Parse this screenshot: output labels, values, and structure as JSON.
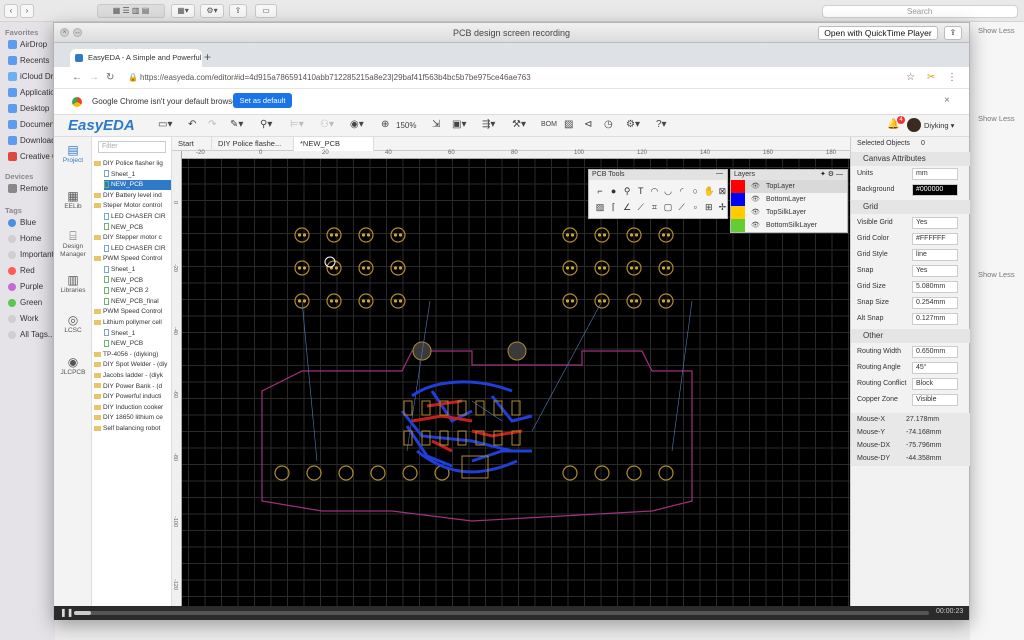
{
  "finder": {
    "search_placeholder": "Search",
    "sidebar": {
      "favorites_title": "Favorites",
      "favorites": [
        "AirDrop",
        "Recents",
        "iCloud Drive",
        "Applications",
        "Desktop",
        "Documents",
        "Downloads",
        "Creative Cloud"
      ],
      "devices_title": "Devices",
      "devices": [
        "Remote"
      ],
      "tags_title": "Tags",
      "tags": [
        {
          "label": "Blue",
          "color": "#4a90e2"
        },
        {
          "label": "Home",
          "color": "#cfcfcf"
        },
        {
          "label": "Important",
          "color": "#cfcfcf"
        },
        {
          "label": "Red",
          "color": "#ff5b50"
        },
        {
          "label": "Purple",
          "color": "#c36ad6"
        },
        {
          "label": "Green",
          "color": "#5ac84e"
        },
        {
          "label": "Work",
          "color": "#cfcfcf"
        },
        {
          "label": "All Tags...",
          "color": "#cfcfcf"
        }
      ]
    },
    "show_less_label": "Show Less"
  },
  "quicktime": {
    "title": "PCB design screen recording",
    "open_button": "Open with QuickTime Player",
    "time": "00:00:23",
    "progress_fraction": 0.02
  },
  "browser": {
    "tab_title": "EasyEDA - A Simple and Powerful Electronic Circuit Design Tool",
    "url": "https://easyeda.com/editor#id=4d915a786591410abb712285215a8e23|29baf41f563b4bc5b7be975ce46ae763",
    "infobar_text": "Google Chrome isn't your default browser",
    "set_default_label": "Set as default"
  },
  "eda": {
    "logo": "EasyEDA",
    "zoom": "150%",
    "bom_label": "BOM",
    "user": "Diyking",
    "notif_count": "4",
    "left_nav": [
      {
        "label": "Project",
        "icon": "folder-icon"
      },
      {
        "label": "EELib",
        "icon": "library-icon"
      },
      {
        "label": "Design Manager",
        "icon": "design-manager-icon"
      },
      {
        "label": "Libraries",
        "icon": "libraries-icon"
      },
      {
        "label": "LCSC",
        "icon": "lcsc-icon"
      },
      {
        "label": "JLCPCB",
        "icon": "jlcpcb-icon"
      }
    ],
    "filter_placeholder": "Filter",
    "tree": [
      {
        "label": "DIY Police flasher lig",
        "type": "folder",
        "indent": 0,
        "selected": false
      },
      {
        "label": "Sheet_1",
        "type": "sch",
        "indent": 1,
        "selected": false
      },
      {
        "label": "NEW_PCB",
        "type": "pcb",
        "indent": 1,
        "selected": true
      },
      {
        "label": "DIY Battery level ind",
        "type": "folder",
        "indent": 0,
        "selected": false
      },
      {
        "label": "Steper Motor control",
        "type": "folder",
        "indent": 0,
        "selected": false
      },
      {
        "label": "LED CHASER CIR",
        "type": "sch",
        "indent": 1,
        "selected": false
      },
      {
        "label": "NEW_PCB",
        "type": "pcb",
        "indent": 1,
        "selected": false
      },
      {
        "label": "DIY Stepper motor c",
        "type": "folder",
        "indent": 0,
        "selected": false
      },
      {
        "label": "LED CHASER CIR",
        "type": "sch",
        "indent": 1,
        "selected": false
      },
      {
        "label": "PWM Speed Control",
        "type": "folder",
        "indent": 0,
        "selected": false
      },
      {
        "label": "Sheet_1",
        "type": "sch",
        "indent": 1,
        "selected": false
      },
      {
        "label": "NEW_PCB",
        "type": "pcb",
        "indent": 1,
        "selected": false
      },
      {
        "label": "NEW_PCB 2",
        "type": "pcb",
        "indent": 1,
        "selected": false
      },
      {
        "label": "NEW_PCB_final",
        "type": "pcb",
        "indent": 1,
        "selected": false
      },
      {
        "label": "PWM Speed Control",
        "type": "folder",
        "indent": 0,
        "selected": false
      },
      {
        "label": "Lithium pollymer cell",
        "type": "folder",
        "indent": 0,
        "selected": false
      },
      {
        "label": "Sheet_1",
        "type": "sch",
        "indent": 1,
        "selected": false
      },
      {
        "label": "NEW_PCB",
        "type": "pcb",
        "indent": 1,
        "selected": false
      },
      {
        "label": "TP-4056 - (diyking)",
        "type": "folder",
        "indent": 0,
        "selected": false
      },
      {
        "label": "DIY Spot Welder - (diy",
        "type": "folder",
        "indent": 0,
        "selected": false
      },
      {
        "label": "Jacobs ladder - (diyk",
        "type": "folder",
        "indent": 0,
        "selected": false
      },
      {
        "label": "DIY Power Bank - (d",
        "type": "folder",
        "indent": 0,
        "selected": false
      },
      {
        "label": "DIY Powerful inducti",
        "type": "folder",
        "indent": 0,
        "selected": false
      },
      {
        "label": "DIY Induction cooker",
        "type": "folder",
        "indent": 0,
        "selected": false
      },
      {
        "label": "DIY 18650 lithium ce",
        "type": "folder",
        "indent": 0,
        "selected": false
      },
      {
        "label": "Self balancing robot",
        "type": "folder",
        "indent": 0,
        "selected": false
      }
    ],
    "doc_tabs": [
      {
        "label": "Start",
        "active": false
      },
      {
        "label": "DIY Police flashe...",
        "active": false
      },
      {
        "label": "*NEW_PCB",
        "active": true
      }
    ],
    "ruler_top": [
      "-20",
      "0",
      "20",
      "40",
      "60",
      "80",
      "100",
      "120",
      "140",
      "160",
      "180"
    ],
    "ruler_left": [
      "0",
      "-20",
      "-40",
      "-60",
      "-80",
      "-100",
      "-120"
    ],
    "pcb_tools_title": "PCB Tools",
    "layers_title": "Layers",
    "layers": [
      {
        "name": "TopLayer",
        "color": "#ff0000",
        "active": true
      },
      {
        "name": "BottomLayer",
        "color": "#0000ff",
        "active": false
      },
      {
        "name": "TopSilkLayer",
        "color": "#ffcc00",
        "active": false
      },
      {
        "name": "BottomSilkLayer",
        "color": "#66cc33",
        "active": false
      }
    ],
    "right_panel": {
      "selected_label": "Selected Objects",
      "selected_count": "0",
      "canvas_attrs_title": "Canvas Attributes",
      "units_label": "Units",
      "units": "mm",
      "background_label": "Background",
      "background": "#000000",
      "grid_title": "Grid",
      "visible_grid_label": "Visible Grid",
      "visible_grid": "Yes",
      "grid_color_label": "Grid Color",
      "grid_color": "#FFFFFF",
      "grid_style_label": "Grid Style",
      "grid_style": "line",
      "snap_label": "Snap",
      "snap": "Yes",
      "grid_size_label": "Grid Size",
      "grid_size": "5.080mm",
      "snap_size_label": "Snap Size",
      "snap_size": "0.254mm",
      "alt_snap_label": "Alt Snap",
      "alt_snap": "0.127mm",
      "other_title": "Other",
      "routing_width_label": "Routing Width",
      "routing_width": "0.650mm",
      "routing_angle_label": "Routing Angle",
      "routing_angle": "45°",
      "routing_conflict_label": "Routing Conflict",
      "routing_conflict": "Block",
      "copper_zone_label": "Copper Zone",
      "copper_zone": "Visible",
      "mouse_x_label": "Mouse-X",
      "mouse_x": "27.178mm",
      "mouse_y_label": "Mouse-Y",
      "mouse_y": "-74.168mm",
      "mouse_dx_label": "Mouse-DX",
      "mouse_dx": "-75.796mm",
      "mouse_dy_label": "Mouse-DY",
      "mouse_dy": "-44.358mm"
    }
  }
}
